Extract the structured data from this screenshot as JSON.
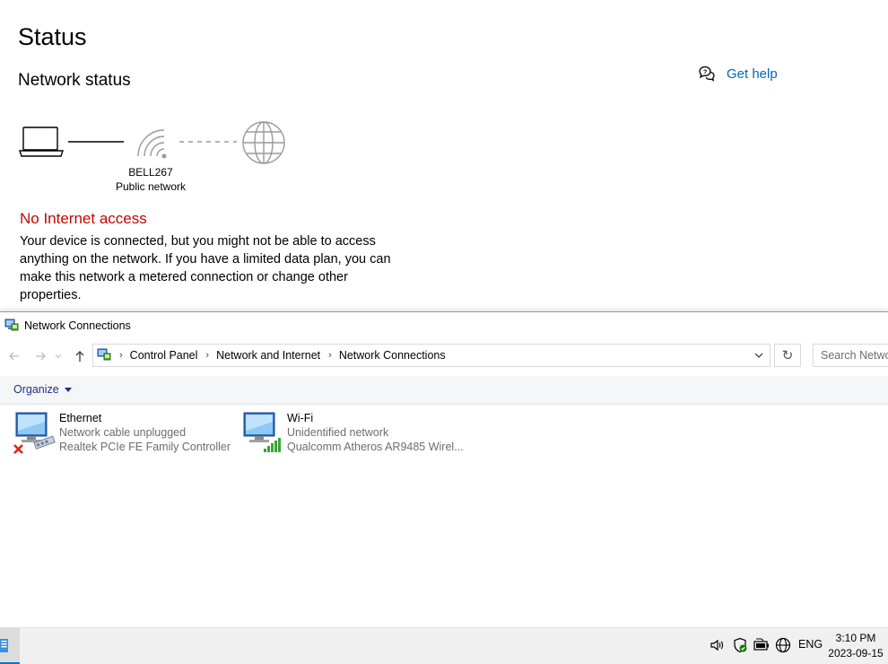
{
  "settings": {
    "title": "Status",
    "section_title": "Network status",
    "get_help": "Get help",
    "network_name": "BELL267",
    "network_type": "Public network",
    "alert_title": "No Internet access",
    "alert_text": "Your device is connected, but you might not be able to access anything on the network. If you have a limited data plan, you can make this network a metered connection or change other properties.",
    "colors": {
      "alert": "#c50500",
      "link": "#0067b8"
    }
  },
  "explorer": {
    "window_title": "Network Connections",
    "breadcrumb": [
      "Control Panel",
      "Network and Internet",
      "Network Connections"
    ],
    "search_placeholder": "Search Network Connections",
    "organize_label": "Organize",
    "connections": [
      {
        "name": "Ethernet",
        "status": "Network cable unplugged",
        "device": "Realtek PCIe FE Family Controller",
        "icon": "ethernet-disconnected-icon"
      },
      {
        "name": "Wi-Fi",
        "status": "Unidentified network",
        "device": "Qualcomm Atheros AR9485 Wirel...",
        "icon": "wifi-signal-icon"
      }
    ]
  },
  "taskbar": {
    "language": "ENG",
    "time": "3:10 PM",
    "date": "2023-09-15",
    "tray_icons": [
      "volume-icon",
      "security-shield-icon",
      "battery-icon",
      "network-globe-icon"
    ]
  }
}
